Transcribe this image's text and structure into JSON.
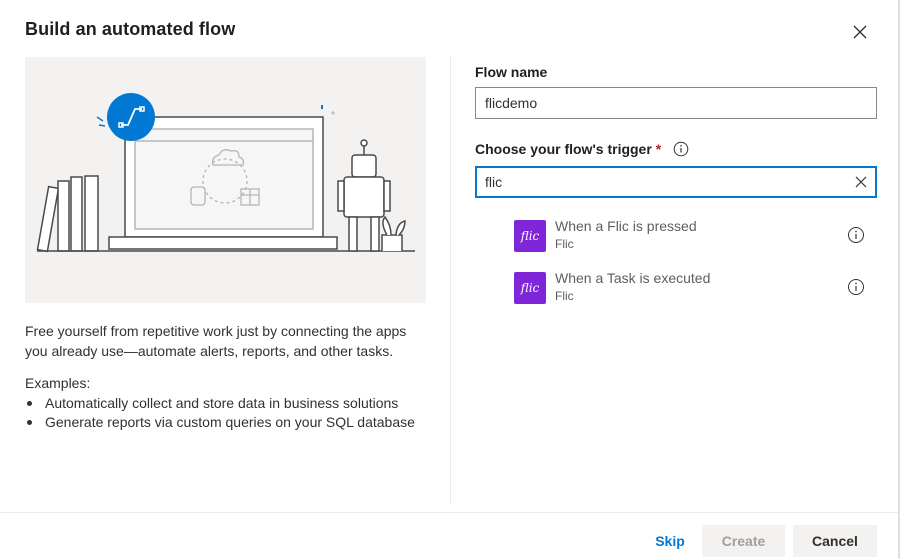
{
  "dialog": {
    "title": "Build an automated flow",
    "close_icon": "close-icon"
  },
  "left_panel": {
    "description": "Free yourself from repetitive work just by connecting the apps you already use—automate alerts, reports, and other tasks.",
    "examples_label": "Examples:",
    "examples": [
      "Automatically collect and store data in business solutions",
      "Generate reports via custom queries on your SQL database"
    ]
  },
  "form": {
    "flow_name_label": "Flow name",
    "flow_name_value": "flicdemo",
    "trigger_label": "Choose your flow's trigger",
    "required_marker": "*",
    "trigger_search_value": "flic",
    "results": [
      {
        "title": "When a Flic is pressed",
        "connector": "Flic",
        "logo_text": "flic"
      },
      {
        "title": "When a Task is executed",
        "connector": "Flic",
        "logo_text": "flic"
      }
    ]
  },
  "footer": {
    "skip_label": "Skip",
    "create_label": "Create",
    "cancel_label": "Cancel"
  },
  "colors": {
    "accent": "#0078d4",
    "flic_brand": "#7f27d8",
    "required": "#a4262c"
  }
}
